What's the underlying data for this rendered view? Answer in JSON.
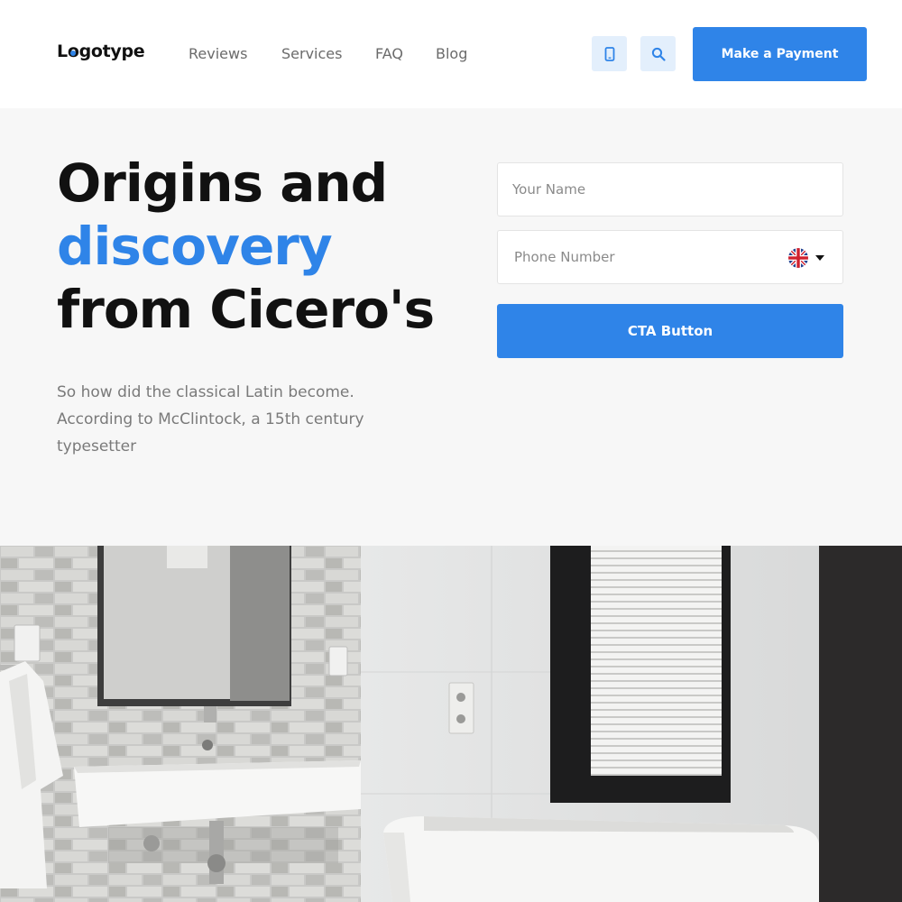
{
  "header": {
    "logo": "Logotype",
    "nav": [
      "Reviews",
      "Services",
      "FAQ",
      "Blog"
    ],
    "phone_icon": "phone-icon",
    "search_icon": "search-icon",
    "payment_button": "Make a Payment"
  },
  "hero": {
    "headline_line1": "Origins and",
    "headline_line2": "discovery",
    "headline_line3": "from Cicero's",
    "subtext": "So how did the classical Latin become. According to McClintock, a 15th century typesetter",
    "form": {
      "name_placeholder": "Your Name",
      "phone_placeholder": "Phone Number",
      "country_flag": "uk-flag-icon",
      "cta_label": "CTA Button"
    }
  },
  "image": {
    "subject": "bathroom-photo"
  },
  "colors": {
    "accent": "#2f84e8",
    "hero_bg": "#f7f7f7",
    "icon_bg": "#e3effc"
  }
}
